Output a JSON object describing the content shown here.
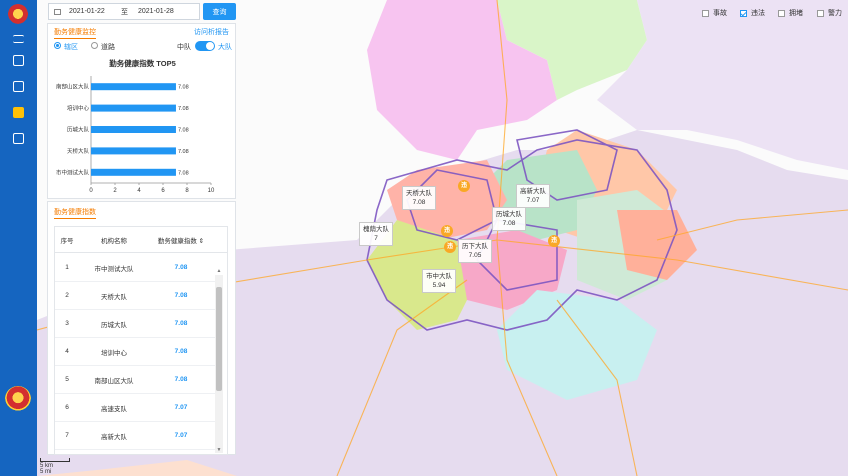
{
  "toolbar": {
    "start_date": "2021-01-22",
    "to_label": "至",
    "end_date": "2021-01-28",
    "query_label": "查询"
  },
  "panel_top": {
    "tab": "勤务健康监控",
    "analysis_link": "访问析报告",
    "radio_district": "辖区",
    "radio_road": "道路",
    "level_left": "中队",
    "level_right": "大队",
    "chart_title": "勤务健康指数 TOP5"
  },
  "chart_data": {
    "type": "bar",
    "orientation": "horizontal",
    "title": "勤务健康指数 TOP5",
    "categories": [
      "南部山区大队",
      "培训中心",
      "历城大队",
      "天桥大队",
      "市中测试大队"
    ],
    "values": [
      7.08,
      7.08,
      7.08,
      7.08,
      7.08
    ],
    "xlim": [
      0,
      10
    ],
    "xticks": [
      0,
      2,
      4,
      6,
      8,
      10
    ],
    "bar_color": "#2196f3"
  },
  "panel_bottom": {
    "tab": "勤务健康指数",
    "columns": [
      "序号",
      "机构名称",
      "勤务健康指数 ⇕"
    ],
    "rows": [
      {
        "no": "1",
        "name": "市中测试大队",
        "score": "7.08"
      },
      {
        "no": "2",
        "name": "天桥大队",
        "score": "7.08"
      },
      {
        "no": "3",
        "name": "历城大队",
        "score": "7.08"
      },
      {
        "no": "4",
        "name": "培训中心",
        "score": "7.08"
      },
      {
        "no": "5",
        "name": "南部山区大队",
        "score": "7.08"
      },
      {
        "no": "6",
        "name": "高速支队",
        "score": "7.07"
      },
      {
        "no": "7",
        "name": "高新大队",
        "score": "7.07"
      }
    ]
  },
  "layers": {
    "accident": "事故",
    "violation": "违法",
    "congestion": "拥堵",
    "police": "警力"
  },
  "map_labels": {
    "tianqiao": {
      "name": "天桥大队",
      "value": "7.08"
    },
    "gaoxin": {
      "name": "高新大队",
      "value": "7.07"
    },
    "licheng": {
      "name": "历城大队",
      "value": "7.08"
    },
    "huaiyin": {
      "name": "槐荫大队",
      "value": "7"
    },
    "lixia": {
      "name": "历下大队",
      "value": "7.05"
    },
    "shizhong": {
      "name": "市中大队",
      "value": "5.94"
    }
  },
  "marker_label": "违",
  "scale": {
    "km": "5 km",
    "mi": "5 mi"
  },
  "colors": {
    "accent": "#2196f3",
    "rail": "#1565c0",
    "tab": "#f57c00",
    "marker": "#f9a825"
  }
}
